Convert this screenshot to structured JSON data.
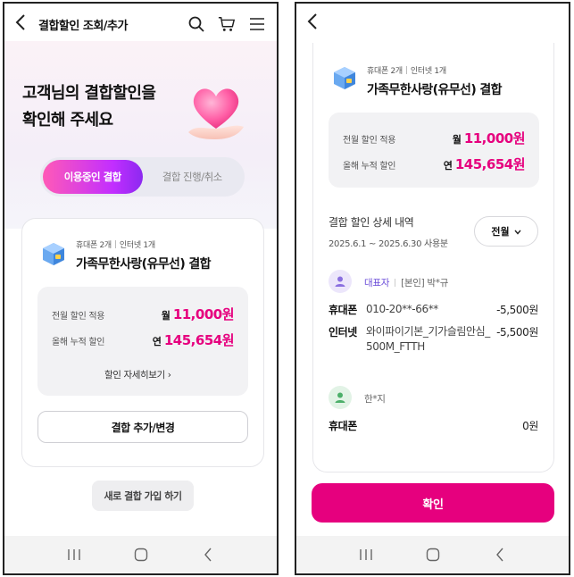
{
  "left_screen": {
    "header": {
      "title": "결합할인 조회/추가"
    },
    "hero": {
      "title": "고객님의 결합할인을\n확인해 주세요"
    },
    "tabs": [
      {
        "label": "이용중인 결합",
        "active": true
      },
      {
        "label": "결합 진행/취소",
        "active": false
      }
    ],
    "card": {
      "tags": [
        "휴대폰 2개",
        "인터넷 1개"
      ],
      "plan_name": "가족무한사랑(유무선) 결합",
      "last_month": {
        "label": "전월 할인 적용",
        "unit": "월",
        "amount": "11,000원"
      },
      "cumulative": {
        "label": "올해 누적 할인",
        "unit": "연",
        "amount": "145,654원"
      },
      "detail_link": "할인 자세히보기 ›",
      "add_change_button": "결합 추가/변경"
    },
    "new_join_button": "새로 결합 가입 하기"
  },
  "right_screen": {
    "card": {
      "tags": [
        "휴대폰 2개",
        "인터넷 1개"
      ],
      "plan_name": "가족무한사랑(유무선) 결합",
      "last_month": {
        "label": "전월 할인 적용",
        "unit": "월",
        "amount": "11,000원"
      },
      "cumulative": {
        "label": "올해 누적 할인",
        "unit": "연",
        "amount": "145,654원"
      }
    },
    "detail": {
      "title": "결합 할인 상세 내역",
      "period": "2025.6.1 ~ 2025.6.30 사용분",
      "dropdown": "전월"
    },
    "members": [
      {
        "role": "대표자",
        "tag": "[본인]",
        "name": "박*규",
        "lines": [
          {
            "type": "휴대폰",
            "desc": "010-20**-66**",
            "price": "-5,500원"
          },
          {
            "type": "인터넷",
            "desc": "와이파이기본_기가슬림안심_500M_FTTH",
            "price": "-5,500원"
          }
        ]
      },
      {
        "name": "한*지",
        "lines": [
          {
            "type": "휴대폰",
            "desc": "",
            "price": "0원"
          }
        ]
      }
    ],
    "confirm_button": "확인"
  },
  "colors": {
    "accent": "#e6007e",
    "purple": "#8c29f0",
    "role": "#6a4cd8"
  }
}
